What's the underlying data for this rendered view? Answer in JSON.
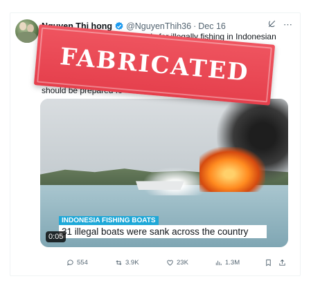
{
  "tweet": {
    "author_name": "Nguyen Thi hong",
    "handle": "@NguyenThih36",
    "separator": "·",
    "date": "Dec 16",
    "text_visible_line1": "vessels for illegally fishing in Indonesian",
    "text_visible_line2": "should be prepared fo",
    "more_icon": "⋯"
  },
  "video": {
    "caption_tag": "INDONESIA FISHING BOATS",
    "caption_main": "31 illegal boats were sank across the country",
    "timecode": "0:05"
  },
  "actions": {
    "replies": "554",
    "reposts": "3.9K",
    "likes": "23K",
    "views": "1.3M"
  },
  "overlay": {
    "label": "FABRICATED",
    "color": "#e53f4c"
  },
  "colors": {
    "verified": "#1d9bf0",
    "secondary_text": "#536471",
    "caption_tag_bg": "#1ea8d8"
  }
}
